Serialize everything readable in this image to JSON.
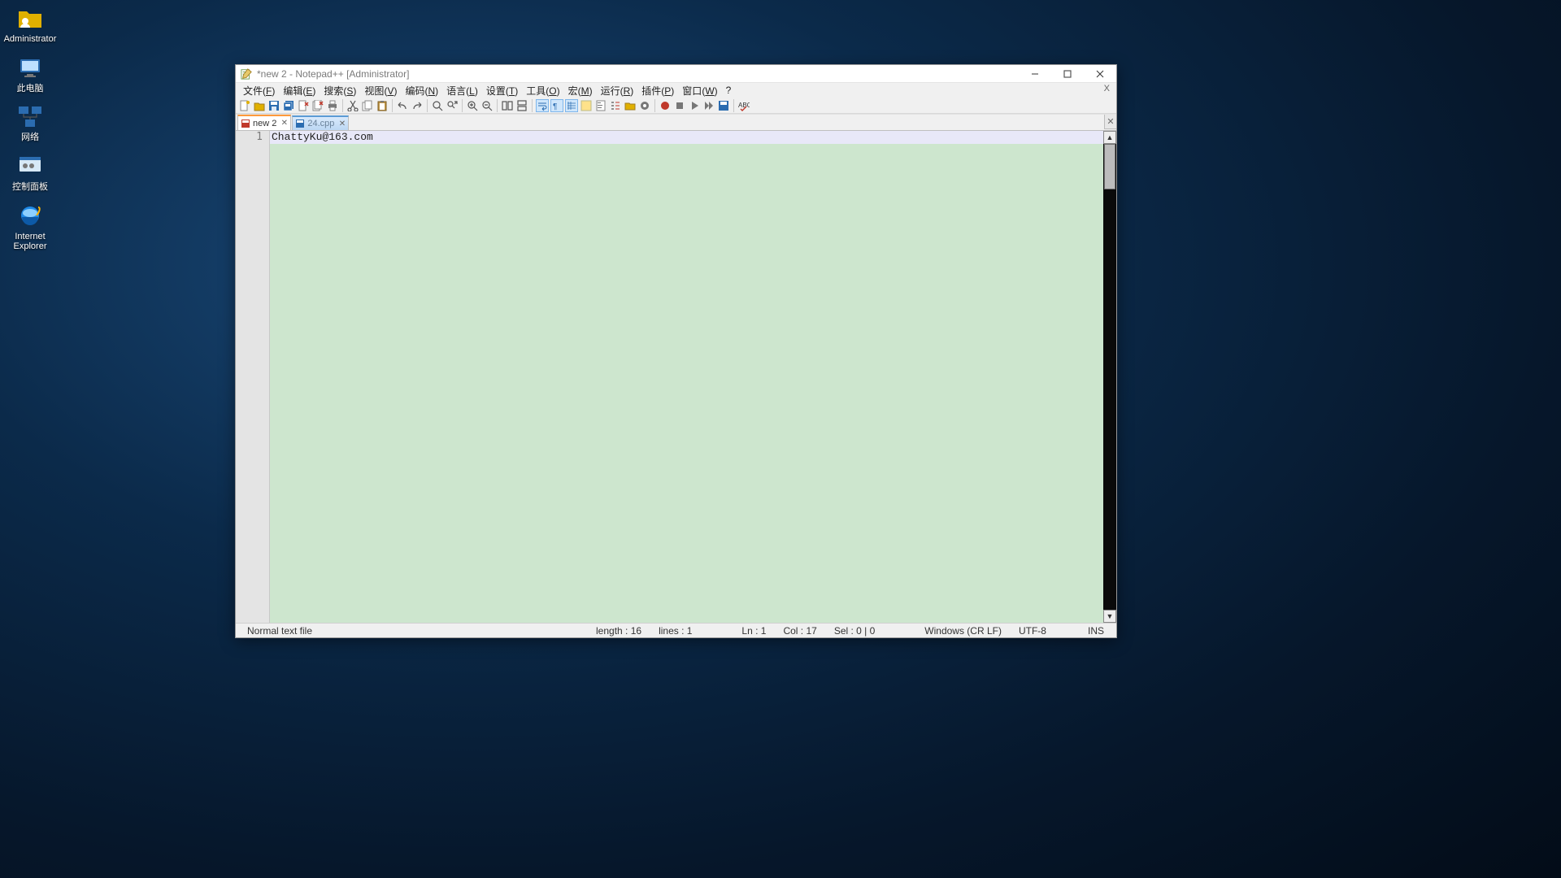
{
  "desktop": {
    "icons": [
      {
        "name": "administrator-icon",
        "label": "Administrator"
      },
      {
        "name": "this-pc-icon",
        "label": "此电脑"
      },
      {
        "name": "network-icon",
        "label": "网络"
      },
      {
        "name": "control-panel-icon",
        "label": "控制面板"
      },
      {
        "name": "internet-explorer-icon",
        "label": "Internet Explorer"
      }
    ]
  },
  "window": {
    "title": "*new 2 - Notepad++ [Administrator]"
  },
  "menu": {
    "items": [
      {
        "label": "文件",
        "accel": "F"
      },
      {
        "label": "编辑",
        "accel": "E"
      },
      {
        "label": "搜索",
        "accel": "S"
      },
      {
        "label": "视图",
        "accel": "V"
      },
      {
        "label": "编码",
        "accel": "N"
      },
      {
        "label": "语言",
        "accel": "L"
      },
      {
        "label": "设置",
        "accel": "T"
      },
      {
        "label": "工具",
        "accel": "O"
      },
      {
        "label": "宏",
        "accel": "M"
      },
      {
        "label": "运行",
        "accel": "R"
      },
      {
        "label": "插件",
        "accel": "P"
      },
      {
        "label": "窗口",
        "accel": "W"
      },
      {
        "label": "?",
        "accel": ""
      }
    ],
    "sub_close": "X"
  },
  "tabs": [
    {
      "label": "new 2",
      "modified": true,
      "active": true
    },
    {
      "label": "24.cpp",
      "modified": false,
      "active": false
    }
  ],
  "editor": {
    "line_number": "1",
    "content": "ChattyKu@163.com"
  },
  "status": {
    "filetype": "Normal text file",
    "length_label": "length : 16",
    "lines_label": "lines : 1",
    "ln_label": "Ln : 1",
    "col_label": "Col : 17",
    "sel_label": "Sel : 0 | 0",
    "eol": "Windows (CR LF)",
    "encoding": "UTF-8",
    "ins": "INS"
  }
}
